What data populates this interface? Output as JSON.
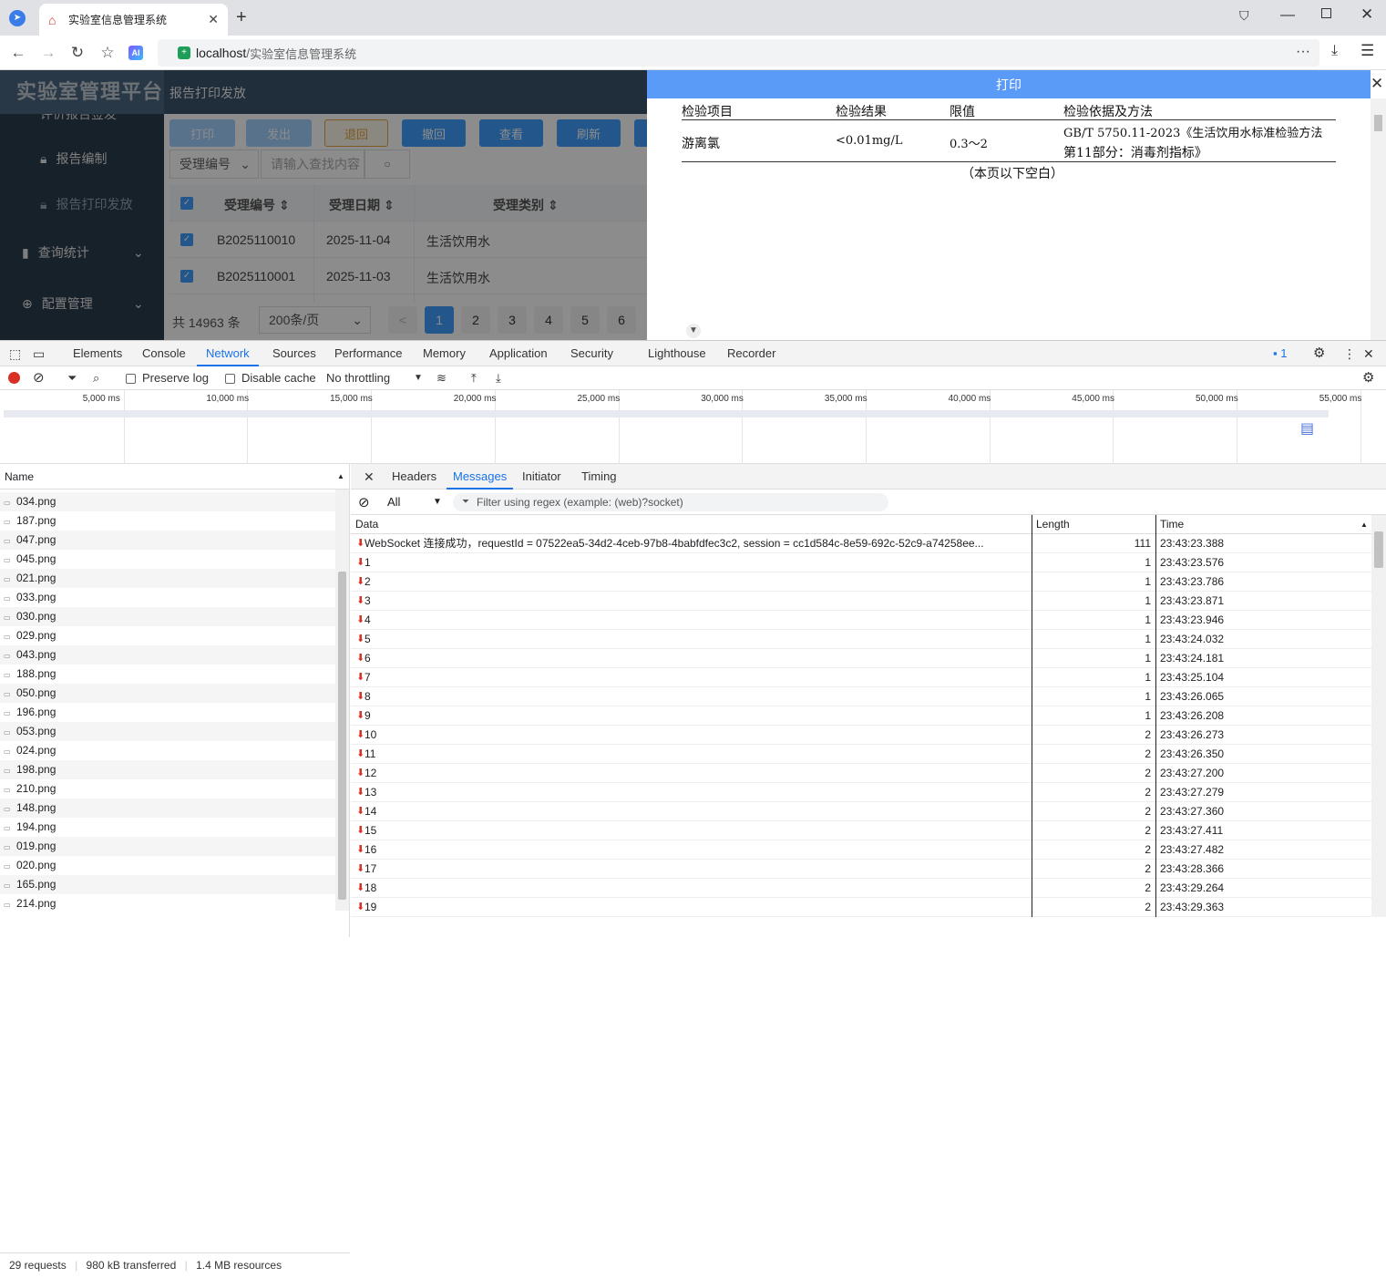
{
  "browser": {
    "tab_title": "实验室信息管理系统",
    "url_host": "localhost",
    "url_sep": " / ",
    "url_title": "实验室信息管理系统",
    "ai_label": "AI"
  },
  "app": {
    "logo": "实验室管理平台",
    "breadcrumb": "报告打印发放",
    "sidebar": [
      {
        "label": "评价报告签发"
      },
      {
        "label": "报告编制"
      },
      {
        "label": "报告打印发放"
      },
      {
        "label": "查询统计"
      },
      {
        "label": "配置管理"
      }
    ],
    "buttons": [
      "打印",
      "发出",
      "退回",
      "撤回",
      "查看",
      "刷新"
    ],
    "search_field": "受理编号",
    "search_placeholder": "请输入查找内容",
    "columns": [
      "受理编号",
      "受理日期",
      "受理类别"
    ],
    "rows": [
      {
        "id": "B2025110010",
        "date": "2025-11-04",
        "type": "生活饮用水"
      },
      {
        "id": "B2025110001",
        "date": "2025-11-03",
        "type": "生活饮用水"
      }
    ],
    "total": "共 14963 条",
    "page_size": "200条/页",
    "pages": [
      "1",
      "2",
      "3",
      "4",
      "5",
      "6"
    ],
    "prev": "<"
  },
  "print_panel": {
    "title": "打印",
    "headers": [
      "检验项目",
      "检验结果",
      "限值",
      "检验依据及方法"
    ],
    "row": {
      "item": "游离氯",
      "result": "<0.01mg/L",
      "limit": "0.3～2",
      "method_line1": "GB/T 5750.11-2023《生活饮用水标准检验方法",
      "method_line2": "第11部分：消毒剂指标》"
    },
    "blank_note": "（本页以下空白）"
  },
  "devtools": {
    "tabs": [
      "Elements",
      "Console",
      "Network",
      "Sources",
      "Performance",
      "Memory",
      "Application",
      "Security",
      "Lighthouse",
      "Recorder"
    ],
    "issues_count": "1",
    "preserve_log": "Preserve log",
    "disable_cache": "Disable cache",
    "throttling": "No throttling",
    "timeline_ticks": [
      "5,000 ms",
      "10,000 ms",
      "15,000 ms",
      "20,000 ms",
      "25,000 ms",
      "30,000 ms",
      "35,000 ms",
      "40,000 ms",
      "45,000 ms",
      "50,000 ms",
      "55,000 ms"
    ],
    "name_header": "Name",
    "files": [
      "034.png",
      "187.png",
      "047.png",
      "045.png",
      "021.png",
      "033.png",
      "030.png",
      "029.png",
      "043.png",
      "188.png",
      "050.png",
      "196.png",
      "053.png",
      "024.png",
      "198.png",
      "210.png",
      "148.png",
      "194.png",
      "019.png",
      "020.png",
      "165.png",
      "214.png"
    ],
    "detail_tabs": [
      "Headers",
      "Messages",
      "Initiator",
      "Timing"
    ],
    "filter_type": "All",
    "filter_placeholder": "Filter using regex (example: (web)?socket)",
    "msg_columns": [
      "Data",
      "Length",
      "Time"
    ],
    "messages": [
      {
        "data": "WebSocket 连接成功，requestId = 07522ea5-34d2-4ceb-97b8-4babfdfec3c2, session = cc1d584c-8e59-692c-52c9-a74258ee...",
        "len": "111",
        "time": "23:43:23.388"
      },
      {
        "data": "1",
        "len": "1",
        "time": "23:43:23.576"
      },
      {
        "data": "2",
        "len": "1",
        "time": "23:43:23.786"
      },
      {
        "data": "3",
        "len": "1",
        "time": "23:43:23.871"
      },
      {
        "data": "4",
        "len": "1",
        "time": "23:43:23.946"
      },
      {
        "data": "5",
        "len": "1",
        "time": "23:43:24.032"
      },
      {
        "data": "6",
        "len": "1",
        "time": "23:43:24.181"
      },
      {
        "data": "7",
        "len": "1",
        "time": "23:43:25.104"
      },
      {
        "data": "8",
        "len": "1",
        "time": "23:43:26.065"
      },
      {
        "data": "9",
        "len": "1",
        "time": "23:43:26.208"
      },
      {
        "data": "10",
        "len": "2",
        "time": "23:43:26.273"
      },
      {
        "data": "11",
        "len": "2",
        "time": "23:43:26.350"
      },
      {
        "data": "12",
        "len": "2",
        "time": "23:43:27.200"
      },
      {
        "data": "13",
        "len": "2",
        "time": "23:43:27.279"
      },
      {
        "data": "14",
        "len": "2",
        "time": "23:43:27.360"
      },
      {
        "data": "15",
        "len": "2",
        "time": "23:43:27.411"
      },
      {
        "data": "16",
        "len": "2",
        "time": "23:43:27.482"
      },
      {
        "data": "17",
        "len": "2",
        "time": "23:43:28.366"
      },
      {
        "data": "18",
        "len": "2",
        "time": "23:43:29.264"
      },
      {
        "data": "19",
        "len": "2",
        "time": "23:43:29.363"
      }
    ],
    "status_requests": "29 requests",
    "status_transferred": "980 kB transferred",
    "status_resources": "1.4 MB resources"
  }
}
